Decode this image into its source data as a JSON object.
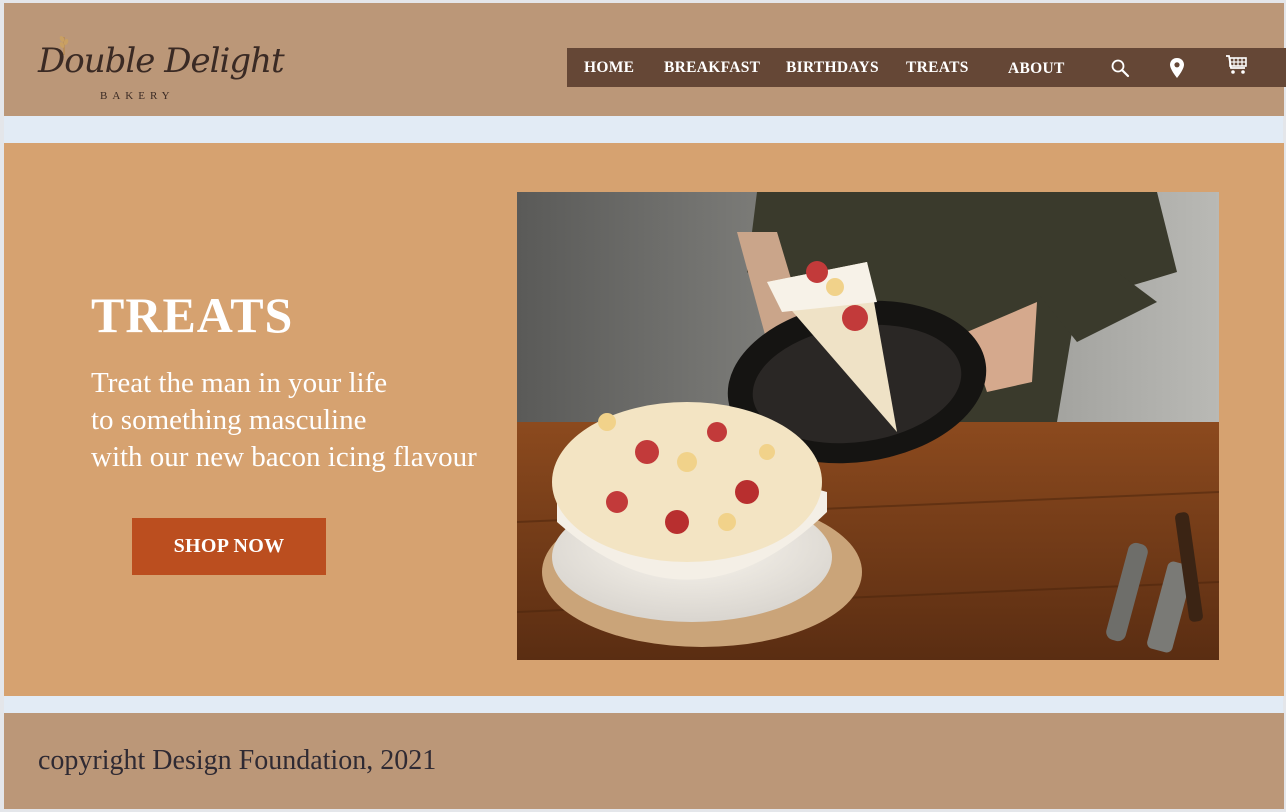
{
  "brand": {
    "name": "Double Delight",
    "tagline": "BAKERY"
  },
  "nav": {
    "items": [
      {
        "label": "HOME"
      },
      {
        "label": "BREAKFAST"
      },
      {
        "label": "BIRTHDAYS"
      },
      {
        "label": "TREATS"
      },
      {
        "label": "ABOUT"
      }
    ],
    "icons": [
      "search-icon",
      "location-pin-icon",
      "shopping-cart-icon"
    ]
  },
  "hero": {
    "title": "TREATS",
    "lines": [
      "Treat the man in your life",
      "to something masculine",
      "with our new bacon icing flavour"
    ],
    "cta_label": "SHOP NOW"
  },
  "footer": {
    "copyright": "copyright Design Foundation, 2021"
  },
  "colors": {
    "header_bg": "#bb9778",
    "nav_bg": "#654736",
    "hero_bg": "#d6a270",
    "cta_bg": "#bb4e1f",
    "page_bg": "#e2ebf5"
  }
}
